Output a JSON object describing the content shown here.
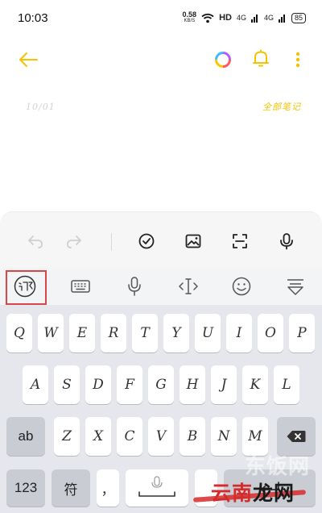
{
  "status_bar": {
    "time": "10:03",
    "net_speed_value": "0.58",
    "net_speed_unit": "KB/S",
    "hd_label": "HD",
    "sig1": "4G",
    "sig2": "4G",
    "battery": "85"
  },
  "note": {
    "date": "10/01",
    "folder": "全部笔记"
  },
  "keyboard": {
    "row1": [
      "Q",
      "W",
      "E",
      "R",
      "T",
      "Y",
      "U",
      "I",
      "O",
      "P"
    ],
    "row2": [
      "A",
      "S",
      "D",
      "F",
      "G",
      "H",
      "J",
      "K",
      "L"
    ],
    "row3": [
      "Z",
      "X",
      "C",
      "V",
      "B",
      "N",
      "M"
    ],
    "shift_label": "ab",
    "num_label": "123",
    "symbol_label": "符",
    "comma_label": "，"
  },
  "watermark": {
    "faint": "东饭网",
    "brand_red": "云南",
    "brand_black": "龙网"
  },
  "colors": {
    "accent": "#f2c400",
    "highlight": "#d9464a",
    "keyboard_bg": "#e5e7ec"
  }
}
